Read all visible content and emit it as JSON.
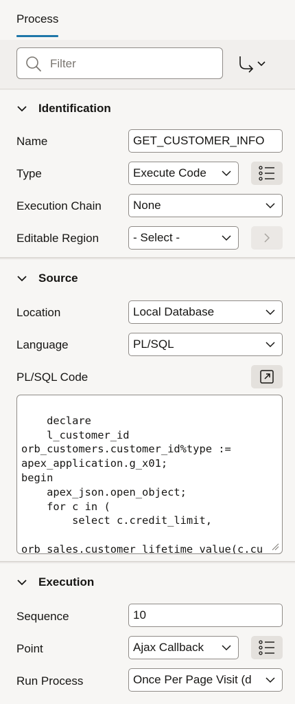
{
  "tabs": [
    {
      "label": "Process",
      "active": true
    }
  ],
  "toolbar": {
    "filter_placeholder": "Filter",
    "goto_icon": "goto-arrow-icon"
  },
  "sections": {
    "identification": {
      "title": "Identification",
      "name_label": "Name",
      "name_value": "GET_CUSTOMER_INFO",
      "type_label": "Type",
      "type_value": "Execute Code",
      "execution_chain_label": "Execution Chain",
      "execution_chain_value": "None",
      "editable_region_label": "Editable Region",
      "editable_region_value": "- Select -"
    },
    "source": {
      "title": "Source",
      "location_label": "Location",
      "location_value": "Local Database",
      "language_label": "Language",
      "language_value": "PL/SQL",
      "code_label": "PL/SQL Code",
      "code": "declare\n    l_customer_id\norb_customers.customer_id%type :=\napex_application.g_x01;\nbegin\n    apex_json.open_object;\n    for c in (\n        select c.credit_limit,\n\norb_sales.customer_lifetime_value(c.cu\nstomer_id) as lifetime_value,"
    },
    "execution": {
      "title": "Execution",
      "sequence_label": "Sequence",
      "sequence_value": "10",
      "point_label": "Point",
      "point_value": "Ajax Callback",
      "run_process_label": "Run Process",
      "run_process_value": "Once Per Page Visit (d"
    }
  },
  "colors": {
    "accent": "#1f77a9",
    "panel_bg": "#f7f6f4",
    "border": "#8f8b87",
    "button_bg": "#e4e1dd"
  }
}
